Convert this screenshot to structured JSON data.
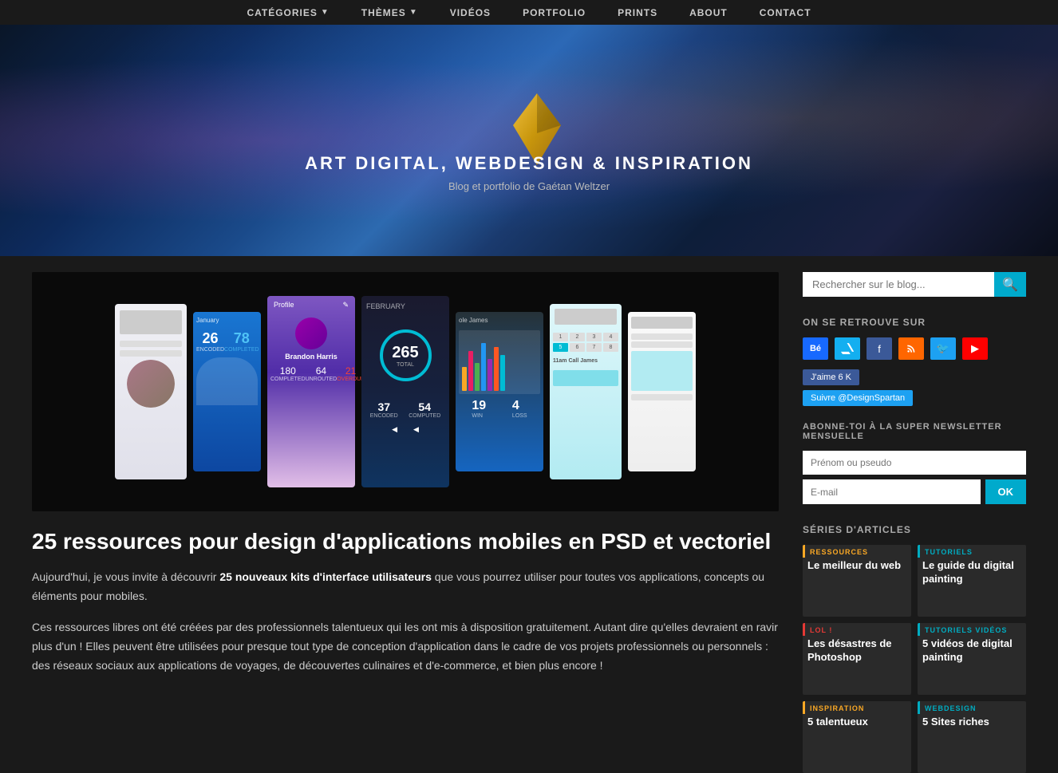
{
  "nav": {
    "items": [
      {
        "label": "CATÉGORIES",
        "hasArrow": true,
        "id": "categories"
      },
      {
        "label": "THÈMES",
        "hasArrow": true,
        "id": "themes"
      },
      {
        "label": "VIDÉOS",
        "hasArrow": false,
        "id": "videos"
      },
      {
        "label": "PORTFOLIO",
        "hasArrow": false,
        "id": "portfolio"
      },
      {
        "label": "PRINTS",
        "hasArrow": false,
        "id": "prints"
      },
      {
        "label": "ABOUT",
        "hasArrow": false,
        "id": "about"
      },
      {
        "label": "CONTACT",
        "hasArrow": false,
        "id": "contact"
      }
    ]
  },
  "hero": {
    "title": "ART DIGITAL, WEBDESIGN & INSPIRATION",
    "subtitle": "Blog et portfolio de Gaétan Weltzer"
  },
  "article": {
    "title": "25 ressources pour design d'applications mobiles en PSD et vectoriel",
    "paragraph1_before": "Aujourd'hui, je vous invite à découvrir ",
    "paragraph1_bold": "25 nouveaux kits d'interface utilisateurs",
    "paragraph1_after": " que vous pourrez utiliser pour toutes vos applications, concepts ou éléments pour mobiles.",
    "paragraph2": "Ces ressources libres ont été créées par des professionnels talentueux qui les ont mis à disposition gratuitement. Autant dire qu'elles devraient en ravir plus d'un ! Elles peuvent être utilisées pour presque tout type de conception d'application dans le cadre de vos projets professionnels ou personnels : des réseaux sociaux aux applications de voyages, de découvertes culinaires et d'e-commerce, et bien plus encore !"
  },
  "sidebar": {
    "search_placeholder": "Rechercher sur le blog...",
    "on_retrouve_title": "ON SE RETROUVE SUR",
    "fb_like": "J'aime  6 K",
    "tw_follow": "Suivre @DesignSpartan",
    "newsletter_title": "ABONNE-TOI À LA SUPER NEWSLETTER MENSUELLE",
    "name_placeholder": "Prénom ou pseudo",
    "email_placeholder": "E-mail",
    "ok_label": "OK",
    "series_title": "SÉRIES D'ARTICLES",
    "series": [
      {
        "label": "RESSOURCES",
        "label_class": "label-ressources",
        "title": "Le meilleur du web"
      },
      {
        "label": "TUTORIELS",
        "label_class": "label-tutoriels",
        "title": "Le guide du digital painting"
      },
      {
        "label": "LOL !",
        "label_class": "label-lol",
        "title": "Les désastres de Photoshop"
      },
      {
        "label": "TUTORIELS VIDÉOS",
        "label_class": "label-tutoriels-videos",
        "title": "5 vidéos de digital painting"
      },
      {
        "label": "INSPIRATION",
        "label_class": "label-inspiration",
        "title": "5 talentueux"
      },
      {
        "label": "WEBDESIGN",
        "label_class": "label-webdesign",
        "title": "5 Sites riches"
      }
    ]
  }
}
